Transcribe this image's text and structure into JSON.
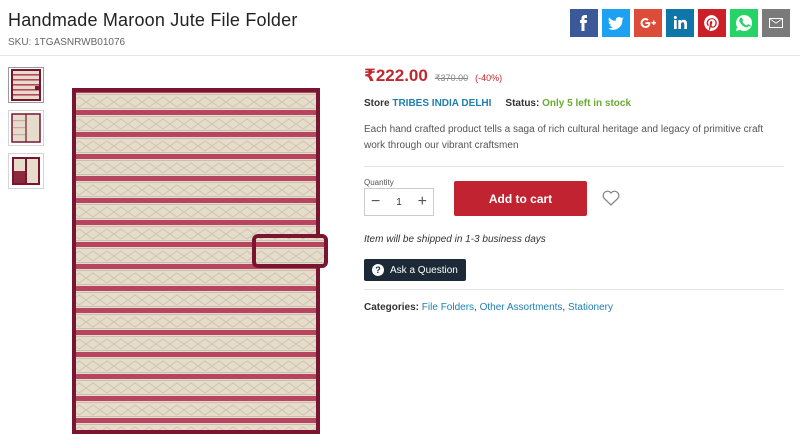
{
  "product": {
    "title": "Handmade Maroon Jute File Folder",
    "sku_label": "SKU:",
    "sku_value": "1TGASNRWB01076",
    "price": "₹222.00",
    "old_price": "₹370.00",
    "discount": "(-40%)",
    "store_label": "Store",
    "store_name": "TRIBES INDIA DELHI",
    "status_label": "Status:",
    "status_value": "Only 5 left in stock",
    "description": "Each hand crafted product tells a saga of rich cultural heritage and legacy of primitive craft work through our vibrant craftsmen",
    "shipping_note": "Item will be shipped in 1-3 business days",
    "categories_label": "Categories:",
    "categories": [
      "File Folders",
      "Other Assortments",
      "Stationery"
    ]
  },
  "cart": {
    "quantity_label": "Quantity",
    "quantity_value": "1",
    "minus": "−",
    "plus": "+",
    "add_to_cart_label": "Add to cart",
    "ask_question_label": "Ask a Question"
  },
  "share": [
    {
      "name": "facebook",
      "glyph": "f",
      "color": "#3b5998"
    },
    {
      "name": "twitter",
      "glyph": "t",
      "color": "#1da1f2"
    },
    {
      "name": "google-plus",
      "glyph": "g+",
      "color": "#dd4b39"
    },
    {
      "name": "linkedin",
      "glyph": "in",
      "color": "#0e76a8"
    },
    {
      "name": "pinterest",
      "glyph": "p",
      "color": "#cb2027"
    },
    {
      "name": "whatsapp",
      "glyph": "w",
      "color": "#25d366"
    },
    {
      "name": "email",
      "glyph": "e",
      "color": "#7a7a7a"
    }
  ],
  "colors": {
    "accent": "#c12330",
    "price": "#c0282d",
    "link": "#1f7fae",
    "stock": "#6aab32",
    "folder_border": "#7a1530",
    "folder_stripe": "#b84560",
    "folder_base": "#e5dccb"
  }
}
